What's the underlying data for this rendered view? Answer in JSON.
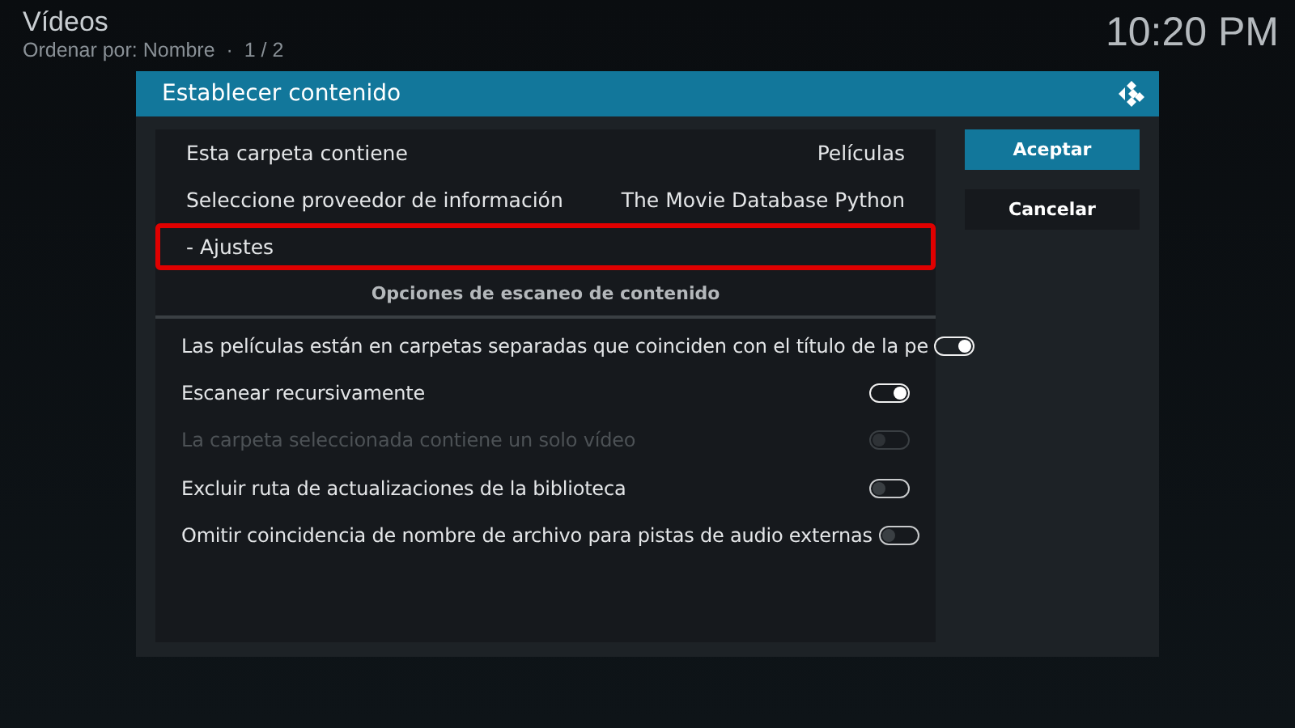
{
  "header": {
    "title": "Vídeos",
    "subtitle": "Ordenar por: Nombre  ·  1 / 2",
    "clock": "10:20 PM"
  },
  "dialog": {
    "title": "Establecer contenido",
    "settings": [
      {
        "label": "Esta carpeta contiene",
        "value": "Películas",
        "highlighted": false
      },
      {
        "label": "Seleccione proveedor de información",
        "value": "The Movie Database Python",
        "highlighted": false
      },
      {
        "label": "- Ajustes",
        "highlighted": true
      }
    ],
    "section_title": "Opciones de escaneo de contenido",
    "options": [
      {
        "label": "Las películas están en carpetas separadas que coinciden con el título de la pe",
        "on": true,
        "disabled": false
      },
      {
        "label": "Escanear recursivamente",
        "on": true,
        "disabled": false
      },
      {
        "label": "La carpeta seleccionada contiene un solo vídeo",
        "on": false,
        "disabled": true
      },
      {
        "label": "Excluir ruta de actualizaciones de la biblioteca",
        "on": false,
        "disabled": false
      },
      {
        "label": "Omitir coincidencia de nombre de archivo para pistas de audio externas",
        "on": false,
        "disabled": false
      }
    ],
    "buttons": [
      {
        "label": "Aceptar",
        "selected": true
      },
      {
        "label": "Cancelar",
        "selected": false
      }
    ]
  }
}
